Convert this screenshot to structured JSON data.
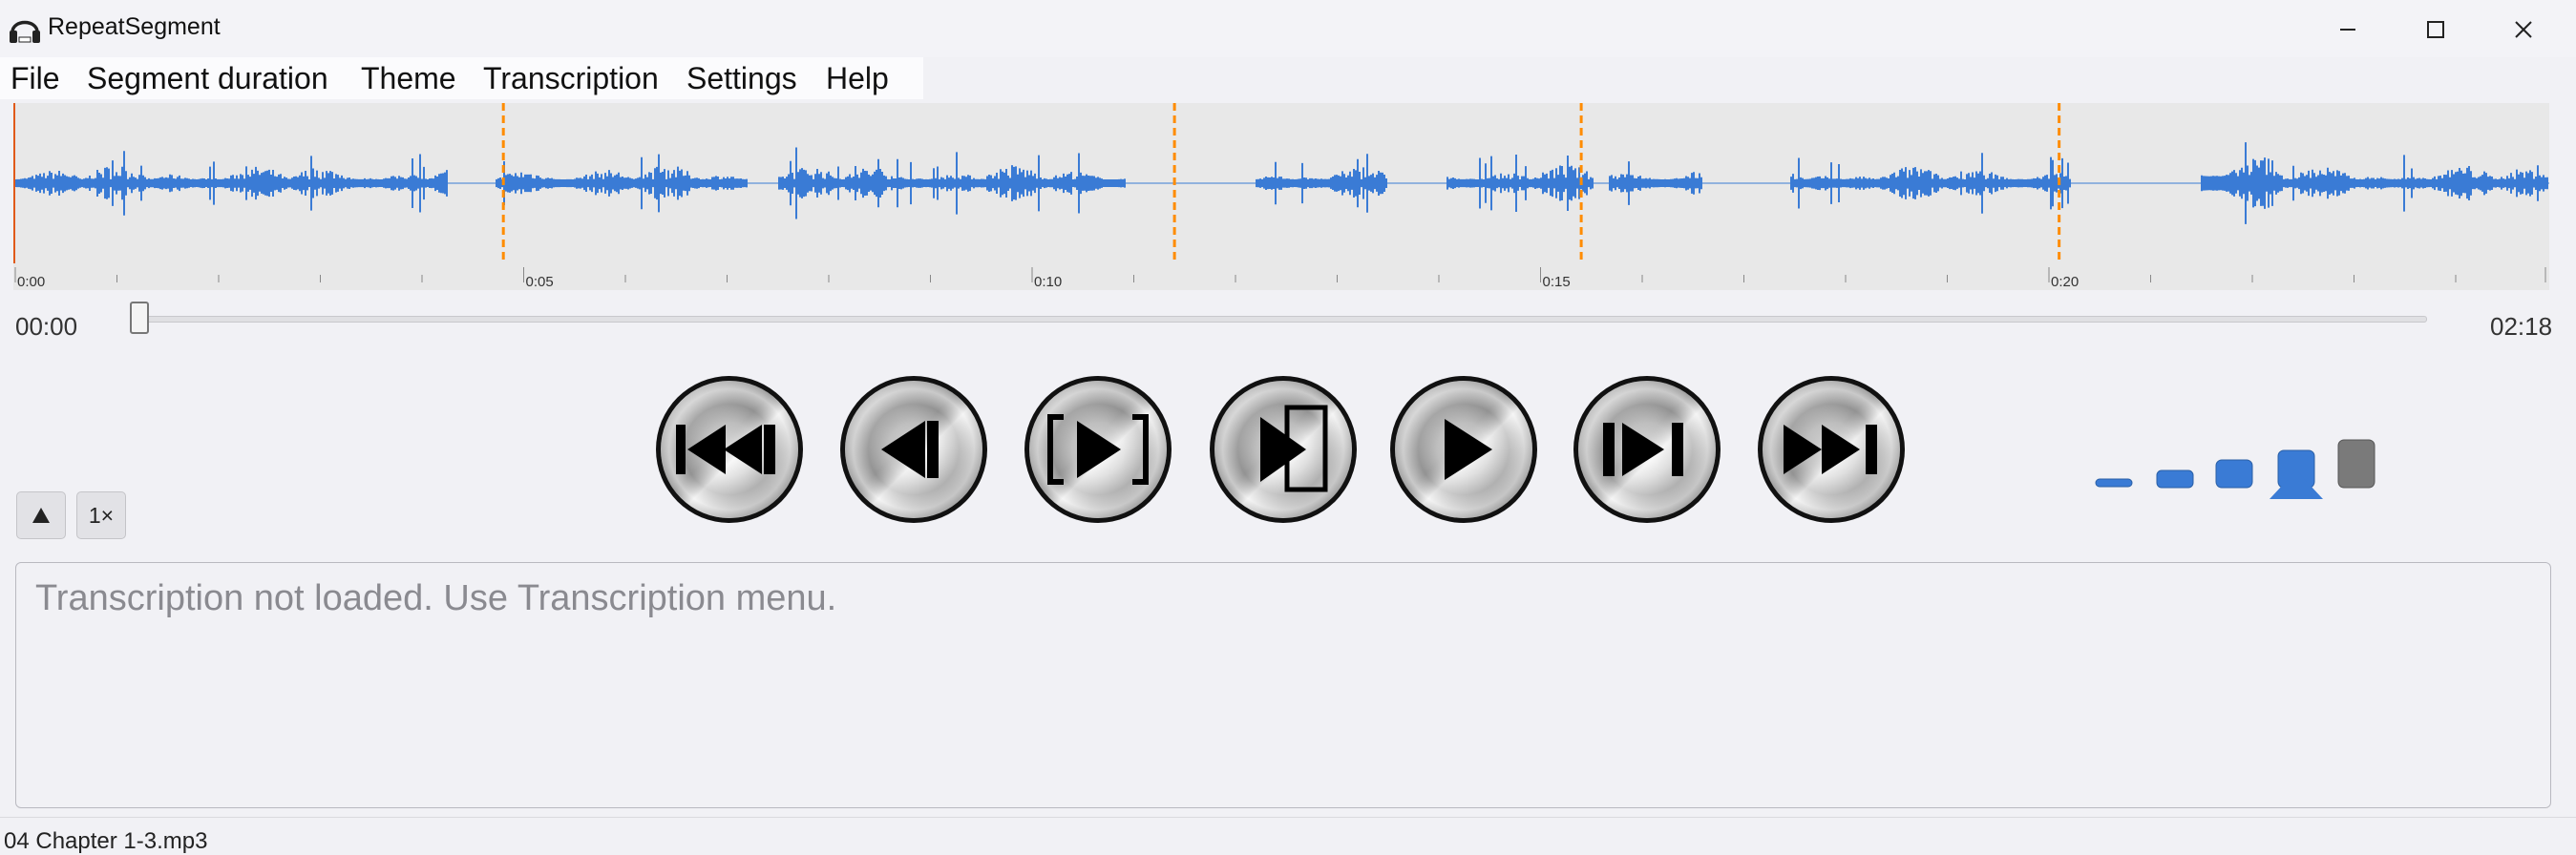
{
  "window": {
    "title": "RepeatSegment",
    "icon": "headphones-icon"
  },
  "window_controls": [
    "minimize-icon",
    "maximize-icon",
    "close-icon"
  ],
  "menu": [
    "File",
    "Segment duration",
    "Theme",
    "Transcription",
    "Settings",
    "Help"
  ],
  "waveform": {
    "tick_labels": [
      "0:00",
      "0:05",
      "0:10",
      "0:15",
      "0:20"
    ],
    "segment_markers_sec": [
      4.8,
      11.4,
      15.4,
      20.1
    ],
    "wave_color": "#3a7bd5",
    "marker_color": "#ff8c00",
    "background": "#e8e8e8"
  },
  "playback": {
    "current_time": "00:00",
    "total_time": "02:18",
    "position_fraction": 0.0
  },
  "controls": [
    {
      "name": "skip-to-start",
      "icon": "skip-to-start-icon"
    },
    {
      "name": "previous-segment",
      "icon": "step-back-icon"
    },
    {
      "name": "repeat-segment",
      "icon": "bracket-play-icon"
    },
    {
      "name": "play-to-segment-end",
      "icon": "play-to-end-icon"
    },
    {
      "name": "play",
      "icon": "play-icon"
    },
    {
      "name": "next-segment",
      "icon": "step-forward-icon"
    },
    {
      "name": "skip-to-end",
      "icon": "skip-to-end-icon"
    }
  ],
  "side_buttons": {
    "collapse_icon": "triangle-up-icon",
    "speed": "1×"
  },
  "font_sizes": {
    "selected_index": 3,
    "selected_color": "#3a7bd5",
    "extra_color": "#7a7a7a"
  },
  "transcription": {
    "placeholder": "Transcription not loaded. Use Transcription menu."
  },
  "status": {
    "filename": "04 Chapter 1-3.mp3"
  }
}
